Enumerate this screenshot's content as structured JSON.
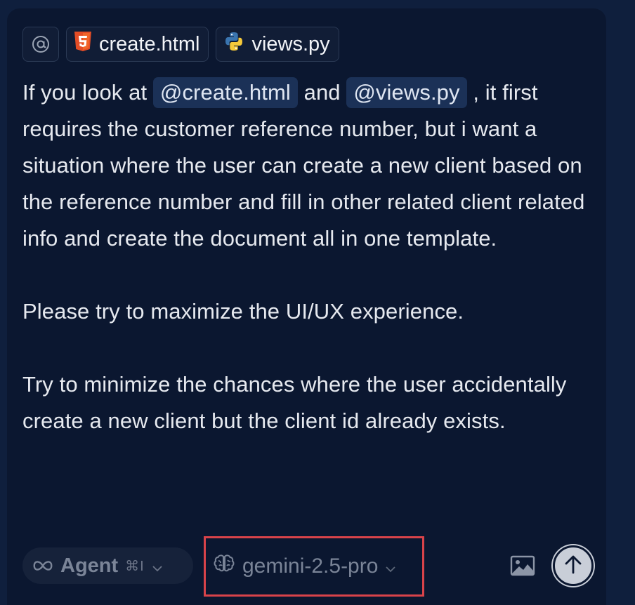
{
  "context_chips": [
    {
      "label": "",
      "icon": "at-sign-icon"
    },
    {
      "label": "create.html",
      "icon": "html5-icon"
    },
    {
      "label": "views.py",
      "icon": "python-icon"
    }
  ],
  "message": {
    "p1": {
      "before": "If you look at ",
      "mention1": "@create.html",
      "middle": " and ",
      "mention2": "@views.py",
      "after": " , it first requires the customer reference number, but i want a situation where the user can create a new client based on the reference number and fill in other related client related info and  create the document all in one template."
    },
    "p2": "Please try to maximize the UI/UX experience.",
    "p3": "Try to minimize the chances where the user accidentally create a new client but the client id already exists."
  },
  "toolbar": {
    "mode_label": "Agent",
    "mode_shortcut": "⌘I",
    "model_label": "gemini-2.5-pro"
  },
  "colors": {
    "background": "#0f1f3d",
    "panel": "#0b1730",
    "mention_bg": "#1b3157",
    "highlight_border": "#d9434a",
    "html5_orange": "#e44d26",
    "python_blue": "#3a75b0",
    "python_yellow": "#f6c93a"
  }
}
